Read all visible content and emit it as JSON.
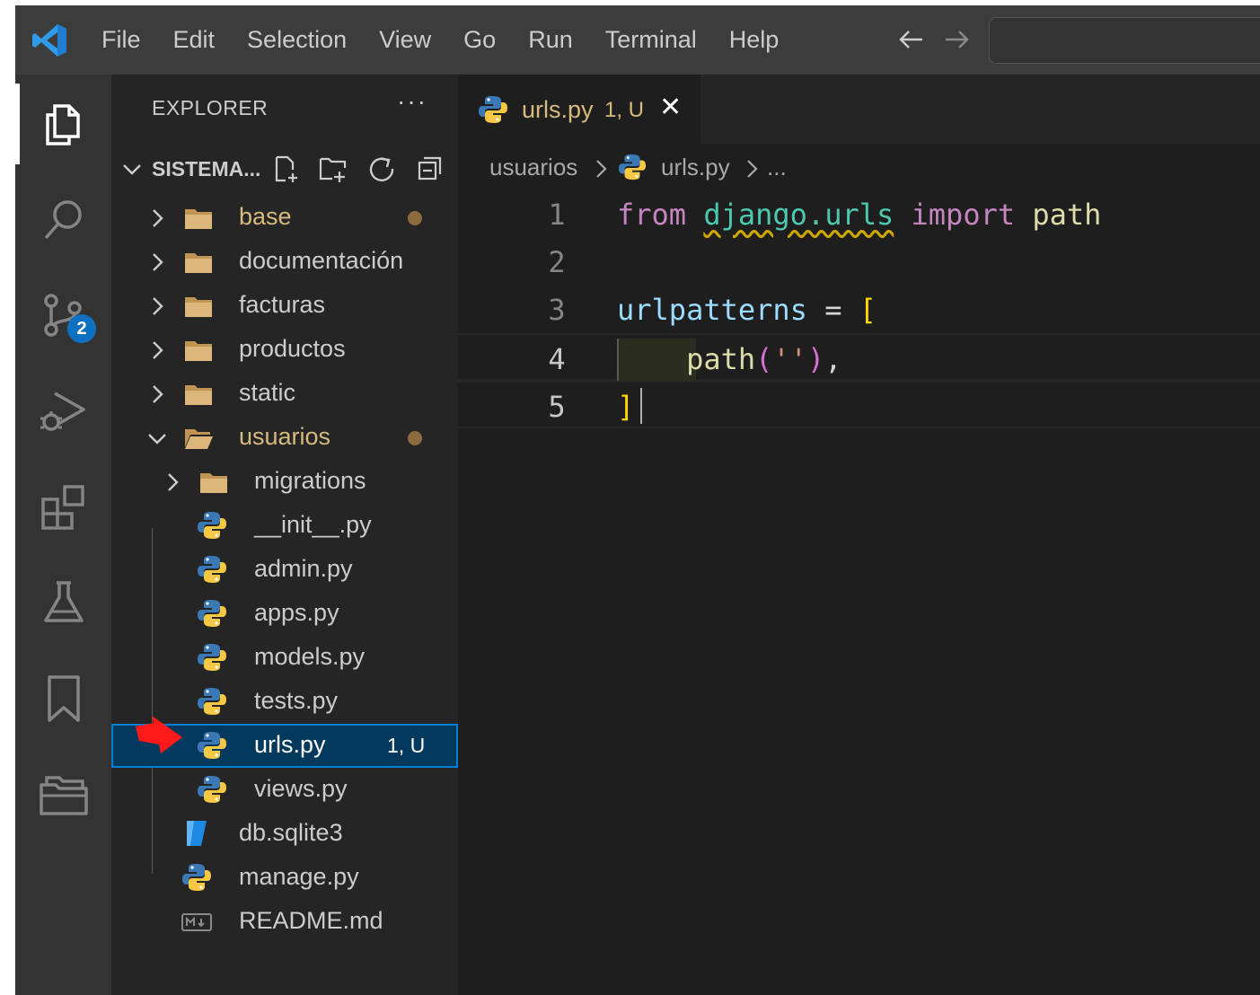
{
  "menu": [
    "File",
    "Edit",
    "Selection",
    "View",
    "Go",
    "Run",
    "Terminal",
    "Help"
  ],
  "activity": {
    "source_control_badge": "2"
  },
  "sidebar": {
    "title": "EXPLORER",
    "more": "···",
    "root": "SISTEMA...",
    "tree": [
      {
        "label": "base",
        "type": "folder",
        "level": 1,
        "expanded": false,
        "modified": true
      },
      {
        "label": "documentación",
        "type": "folder",
        "level": 1,
        "expanded": false
      },
      {
        "label": "facturas",
        "type": "folder",
        "level": 1,
        "expanded": false
      },
      {
        "label": "productos",
        "type": "folder",
        "level": 1,
        "expanded": false
      },
      {
        "label": "static",
        "type": "folder",
        "level": 1,
        "expanded": false
      },
      {
        "label": "usuarios",
        "type": "folder",
        "level": 1,
        "expanded": true,
        "modified": true
      },
      {
        "label": "migrations",
        "type": "folder",
        "level": 2,
        "expanded": false
      },
      {
        "label": "__init__.py",
        "type": "python",
        "level": 2
      },
      {
        "label": "admin.py",
        "type": "python",
        "level": 2
      },
      {
        "label": "apps.py",
        "type": "python",
        "level": 2
      },
      {
        "label": "models.py",
        "type": "python",
        "level": 2
      },
      {
        "label": "tests.py",
        "type": "python",
        "level": 2
      },
      {
        "label": "urls.py",
        "type": "python",
        "level": 2,
        "selected": true,
        "status": "1, U"
      },
      {
        "label": "views.py",
        "type": "python",
        "level": 2
      },
      {
        "label": "db.sqlite3",
        "type": "database",
        "level": 1
      },
      {
        "label": "manage.py",
        "type": "python",
        "level": 1
      },
      {
        "label": "README.md",
        "type": "markdown",
        "level": 1
      }
    ]
  },
  "editor": {
    "tab": {
      "label": "urls.py",
      "status": "1, U",
      "close": "✕"
    },
    "breadcrumbs": [
      "usuarios",
      "urls.py",
      "..."
    ],
    "line_numbers": [
      "1",
      "2",
      "3",
      "4",
      "5"
    ]
  },
  "colors": {
    "accent": "#007fd4",
    "modified": "#d7ba7d",
    "badge": "#0e70c0"
  }
}
